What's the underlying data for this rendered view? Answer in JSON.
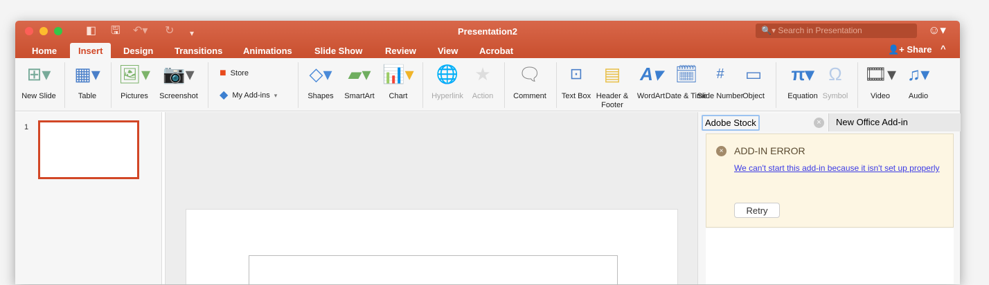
{
  "window": {
    "title": "Presentation2",
    "search_placeholder": "Search in Presentation",
    "share_label": "Share"
  },
  "tabs": [
    "Home",
    "Insert",
    "Design",
    "Transitions",
    "Animations",
    "Slide Show",
    "Review",
    "View",
    "Acrobat"
  ],
  "active_tab": "Insert",
  "ribbon": {
    "new_slide": "New Slide",
    "table": "Table",
    "pictures": "Pictures",
    "screenshot": "Screenshot",
    "store": "Store",
    "my_addins": "My Add-ins",
    "shapes": "Shapes",
    "smartart": "SmartArt",
    "chart": "Chart",
    "hyperlink": "Hyperlink",
    "action": "Action",
    "comment": "Comment",
    "text_box": "Text Box",
    "header_footer": "Header & Footer",
    "wordart": "WordArt",
    "date_time": "Date & Time",
    "slide_number": "Slide Number",
    "object": "Object",
    "equation": "Equation",
    "symbol": "Symbol",
    "video": "Video",
    "audio": "Audio"
  },
  "slides": {
    "number": "1"
  },
  "pane": {
    "tab1": "Adobe Stock",
    "tab2": "New Office Add-in",
    "error_title": "ADD-IN ERROR",
    "error_message": "We can't start this add-in because it isn't set up properly",
    "retry_label": "Retry"
  }
}
